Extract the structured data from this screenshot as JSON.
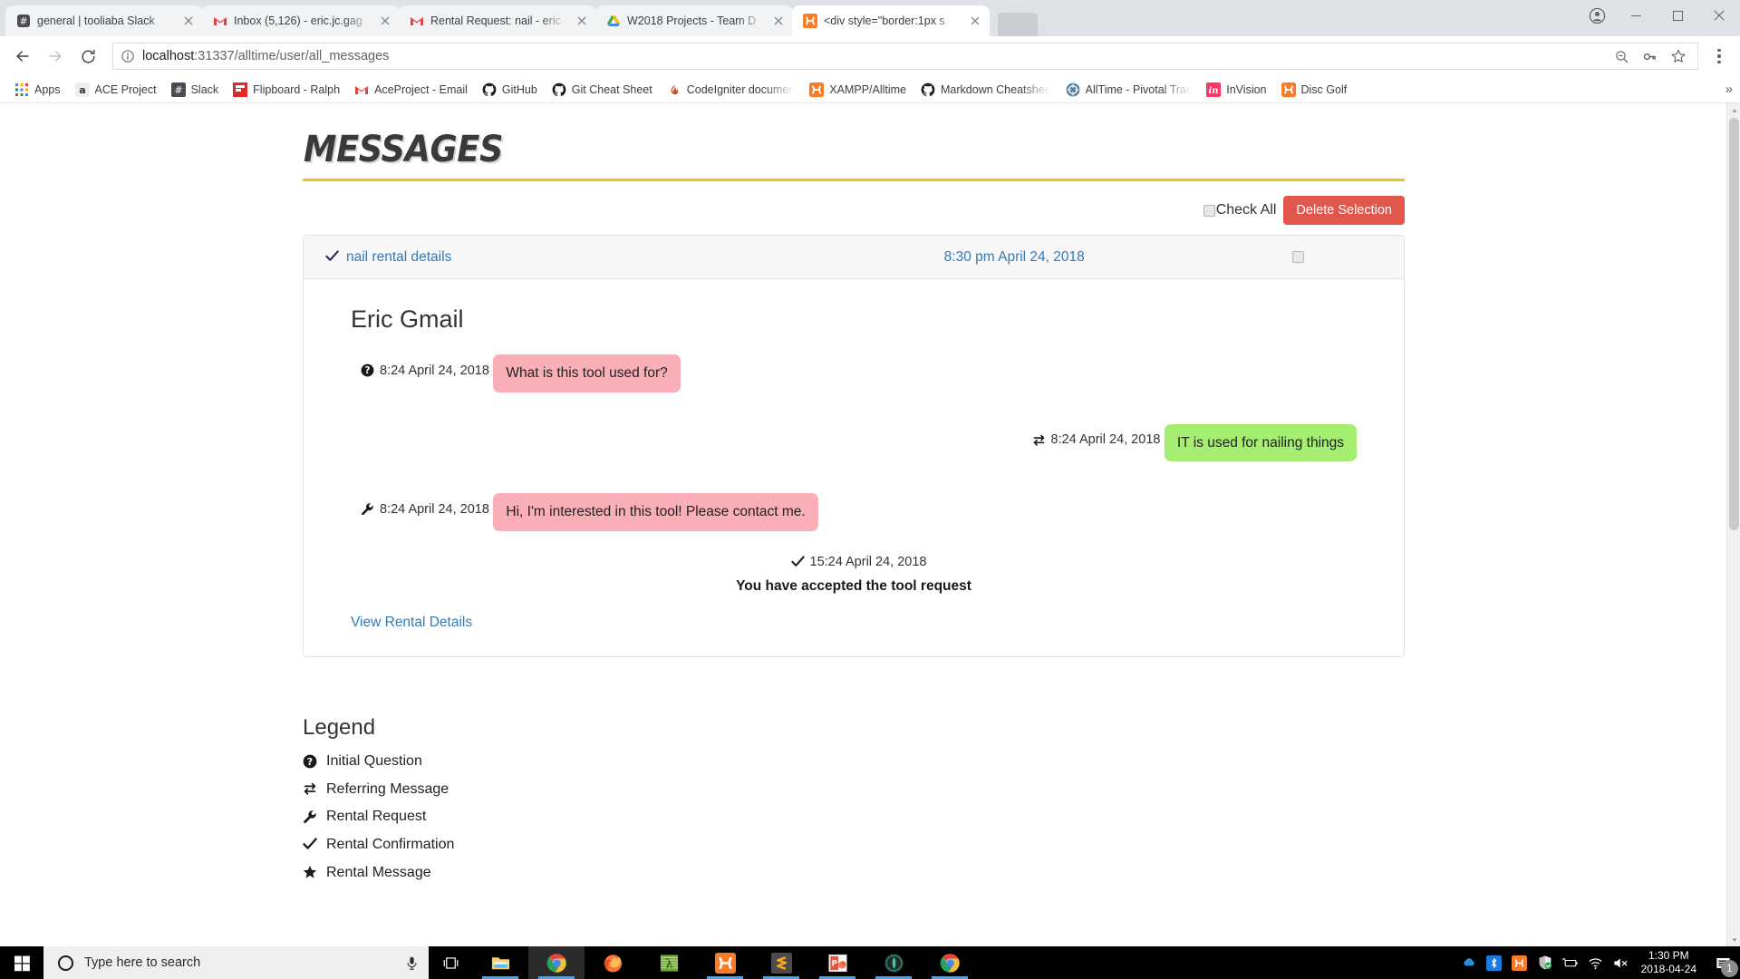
{
  "browser": {
    "tabs": [
      {
        "title": "general | tooliaba Slack",
        "favicon": "slack-icon",
        "active": false
      },
      {
        "title": "Inbox (5,126) - eric.jc.gag",
        "favicon": "gmail-icon",
        "active": false
      },
      {
        "title": "Rental Request: nail - eric",
        "favicon": "gmail-icon",
        "active": false
      },
      {
        "title": "W2018 Projects - Team D",
        "favicon": "google-drive-icon",
        "active": false
      },
      {
        "title": "<div style=\"border:1px s",
        "favicon": "xampp-icon",
        "active": true
      }
    ],
    "address_bar": {
      "host": "localhost",
      "path": ":31337/alltime/user/all_messages",
      "full_url": "localhost:31337/alltime/user/all_messages",
      "security_icon": "info-circle-icon"
    },
    "toolbar_icons": [
      "back-icon",
      "forward-icon",
      "reload-icon",
      "zoom-out-icon",
      "password-key-icon",
      "bookmark-star-icon",
      "chrome-menu-icon"
    ],
    "window_controls": [
      "profile-icon",
      "minimize-icon",
      "maximize-icon",
      "close-icon"
    ],
    "bookmarks": [
      {
        "label": "Apps",
        "icon": "apps-grid-icon"
      },
      {
        "label": "ACE Project",
        "icon": "amazon-a-icon"
      },
      {
        "label": "Slack",
        "icon": "slack-hash-icon"
      },
      {
        "label": "Flipboard - Ralph",
        "icon": "flipboard-icon"
      },
      {
        "label": "AceProject - Email",
        "icon": "gmail-icon"
      },
      {
        "label": "GitHub",
        "icon": "github-icon"
      },
      {
        "label": "Git Cheat Sheet",
        "icon": "github-icon"
      },
      {
        "label": "CodeIgniter documen",
        "icon": "codeigniter-flame-icon"
      },
      {
        "label": "XAMPP/Alltime",
        "icon": "xampp-icon"
      },
      {
        "label": "Markdown Cheatshee",
        "icon": "github-icon"
      },
      {
        "label": "AllTime - Pivotal Trac",
        "icon": "pivotal-tracker-icon"
      },
      {
        "label": "InVision",
        "icon": "invision-icon"
      },
      {
        "label": "Disc Golf",
        "icon": "xampp-icon"
      }
    ],
    "bookmarks_overflow": "»"
  },
  "page": {
    "title": "MESSAGES",
    "toolbar": {
      "check_all_label": "Check All",
      "delete_label": "Delete Selection"
    },
    "conversation": {
      "subject": "nail rental details",
      "subject_icon": "check-icon",
      "header_date": "8:30 pm April 24, 2018",
      "sender": "Eric Gmail",
      "messages": [
        {
          "icon": "question-circle-icon",
          "icon_name": "Initial Question",
          "timestamp": "8:24 April 24, 2018",
          "text": "What is this tool used for?",
          "side": "left",
          "color": "pink"
        },
        {
          "icon": "exchange-icon",
          "icon_name": "Referring Message",
          "timestamp": "8:24 April 24, 2018",
          "text": "IT is used for nailing things",
          "side": "right",
          "color": "green"
        },
        {
          "icon": "wrench-icon",
          "icon_name": "Rental Request",
          "timestamp": "8:24 April 24, 2018",
          "text": "Hi, I'm interested in this tool! Please contact me.",
          "side": "left",
          "color": "pink"
        }
      ],
      "confirmation": {
        "icon": "check-icon",
        "timestamp": "15:24 April 24, 2018",
        "text": "You have accepted the tool request"
      },
      "details_link": "View Rental Details"
    },
    "legend": {
      "heading": "Legend",
      "items": [
        {
          "icon": "question-circle-icon",
          "label": "Initial Question"
        },
        {
          "icon": "exchange-icon",
          "label": "Referring Message"
        },
        {
          "icon": "wrench-icon",
          "label": "Rental Request"
        },
        {
          "icon": "check-icon",
          "label": "Rental Confirmation"
        },
        {
          "icon": "star-icon",
          "label": "Rental Message"
        }
      ]
    },
    "colors": {
      "accent_underline": "#f0c419",
      "delete_button": "#e2574c",
      "incoming_bubble": "#f9aeb8",
      "outgoing_bubble": "#a6ee72",
      "link": "#337ab7"
    }
  },
  "taskbar": {
    "search_placeholder": "Type here to search",
    "icons": [
      "start-icon",
      "cortana-circle-icon",
      "microphone-icon",
      "task-view-icon"
    ],
    "apps": [
      {
        "name": "file-explorer-icon",
        "open": true,
        "active": false
      },
      {
        "name": "google-chrome-icon",
        "open": true,
        "active": true
      },
      {
        "name": "firefox-icon",
        "open": false,
        "active": false
      },
      {
        "name": "lambda-editor-icon",
        "open": false,
        "active": false
      },
      {
        "name": "xampp-icon",
        "open": true,
        "active": false
      },
      {
        "name": "sublime-text-icon",
        "open": true,
        "active": false
      },
      {
        "name": "powerpoint-icon",
        "open": true,
        "active": false
      },
      {
        "name": "dark-circle-app-icon",
        "open": true,
        "active": false
      },
      {
        "name": "google-chrome-icon",
        "open": true,
        "active": false
      }
    ],
    "tray": [
      "onedrive-icon",
      "bluetooth-icon",
      "xampp-icon",
      "windows-defender-icon",
      "battery-icon",
      "wifi-icon",
      "volume-muted-icon"
    ],
    "clock_time": "1:30 PM",
    "clock_date": "2018-04-24",
    "notification_count": "1"
  }
}
